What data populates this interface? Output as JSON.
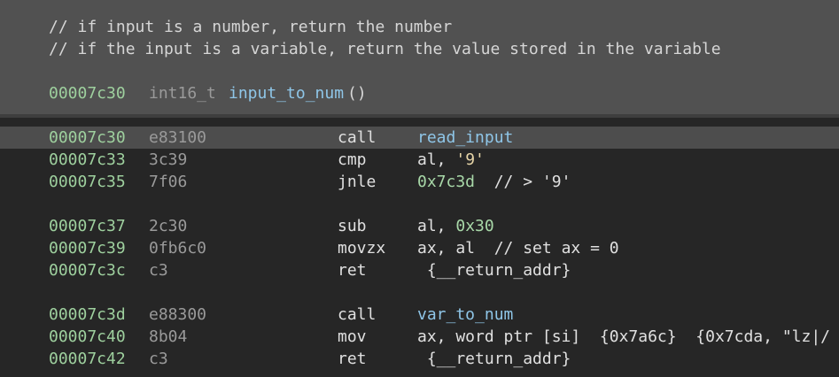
{
  "header": {
    "comment1": "// if input is a number, return the number",
    "comment2": "// if the input is a variable, return the value stored in the variable",
    "signature": {
      "address": "00007c30",
      "return_type": "int16_t",
      "name": "input_to_num",
      "parens": "()"
    }
  },
  "rows": [
    {
      "address": "00007c30",
      "bytes": "e83100",
      "mnemonic": "call",
      "operand_symbol": "read_input"
    },
    {
      "address": "00007c33",
      "bytes": "3c39",
      "mnemonic": "cmp",
      "operand_text": "al, ",
      "operand_string": "'9'"
    },
    {
      "address": "00007c35",
      "bytes": "7f06",
      "mnemonic": "jnle",
      "operand_number": "0x7c3d",
      "comment": "  // > '9'"
    },
    {
      "address": "00007c37",
      "bytes": "2c30",
      "mnemonic": "sub",
      "operand_text": "al, ",
      "operand_number": "0x30"
    },
    {
      "address": "00007c39",
      "bytes": "0fb6c0",
      "mnemonic": "movzx",
      "operand_text": "ax, al",
      "comment": "  // set ax = 0"
    },
    {
      "address": "00007c3c",
      "bytes": "c3",
      "mnemonic": "ret",
      "operand_text": " {__return_addr}"
    },
    {
      "address": "00007c3d",
      "bytes": "e88300",
      "mnemonic": "call",
      "operand_symbol": "var_to_num"
    },
    {
      "address": "00007c40",
      "bytes": "8b04",
      "mnemonic": "mov",
      "operand_text": "ax, word ptr [si]  ",
      "operand_brace1": "{0x7a6c}",
      "operand_brace2": "  {0x7cda, \"lz|/"
    },
    {
      "address": "00007c42",
      "bytes": "c3",
      "mnemonic": "ret",
      "operand_text": " {__return_addr}"
    }
  ],
  "colors": {
    "header_bg": "#515151",
    "body_bg": "#262626",
    "address": "#9ed09e",
    "symbol": "#8fc6e8",
    "highlight": "#4d4d4d"
  }
}
